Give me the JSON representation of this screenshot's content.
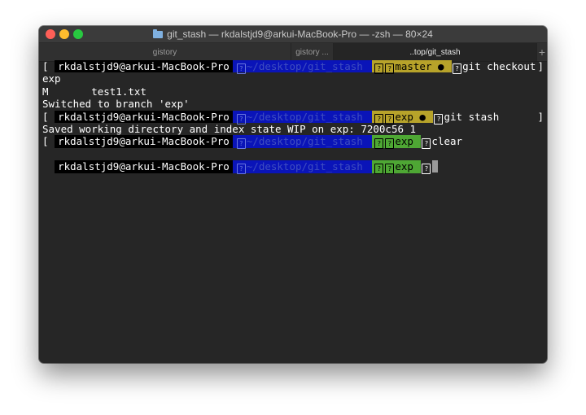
{
  "window": {
    "title": "git_stash — rkdalstjd9@arkui-MacBook-Pro — -zsh — 80×24"
  },
  "tabs": [
    {
      "label": "gistory"
    },
    {
      "label": "gistory ..."
    },
    {
      "label": "..top/git_stash"
    },
    {
      "label": "+"
    }
  ],
  "prompt": {
    "user": "rkdalstjd9@arkui-MacBook-Pro",
    "path": "~/desktop/git_stash",
    "branch_master": "master ●",
    "branch_exp_dirty": "exp ●",
    "branch_exp": "exp",
    "icon_glyph": "?",
    "bracket_left": "[",
    "bracket_right": "]"
  },
  "commands": {
    "checkout": "git checkout",
    "checkout_wrap": "exp",
    "stash": "git stash",
    "clear": "clear"
  },
  "output": {
    "modified_line": "M       test1.txt",
    "switched": "Switched to branch 'exp'",
    "saved": "Saved working directory and index state WIP on exp: 7200c56 1"
  },
  "colors": {
    "terminal_bg": "#262626",
    "path_bg": "#0a14b8",
    "branch_master_bg": "#b7a32a",
    "branch_clean_bg": "#4ea734"
  }
}
